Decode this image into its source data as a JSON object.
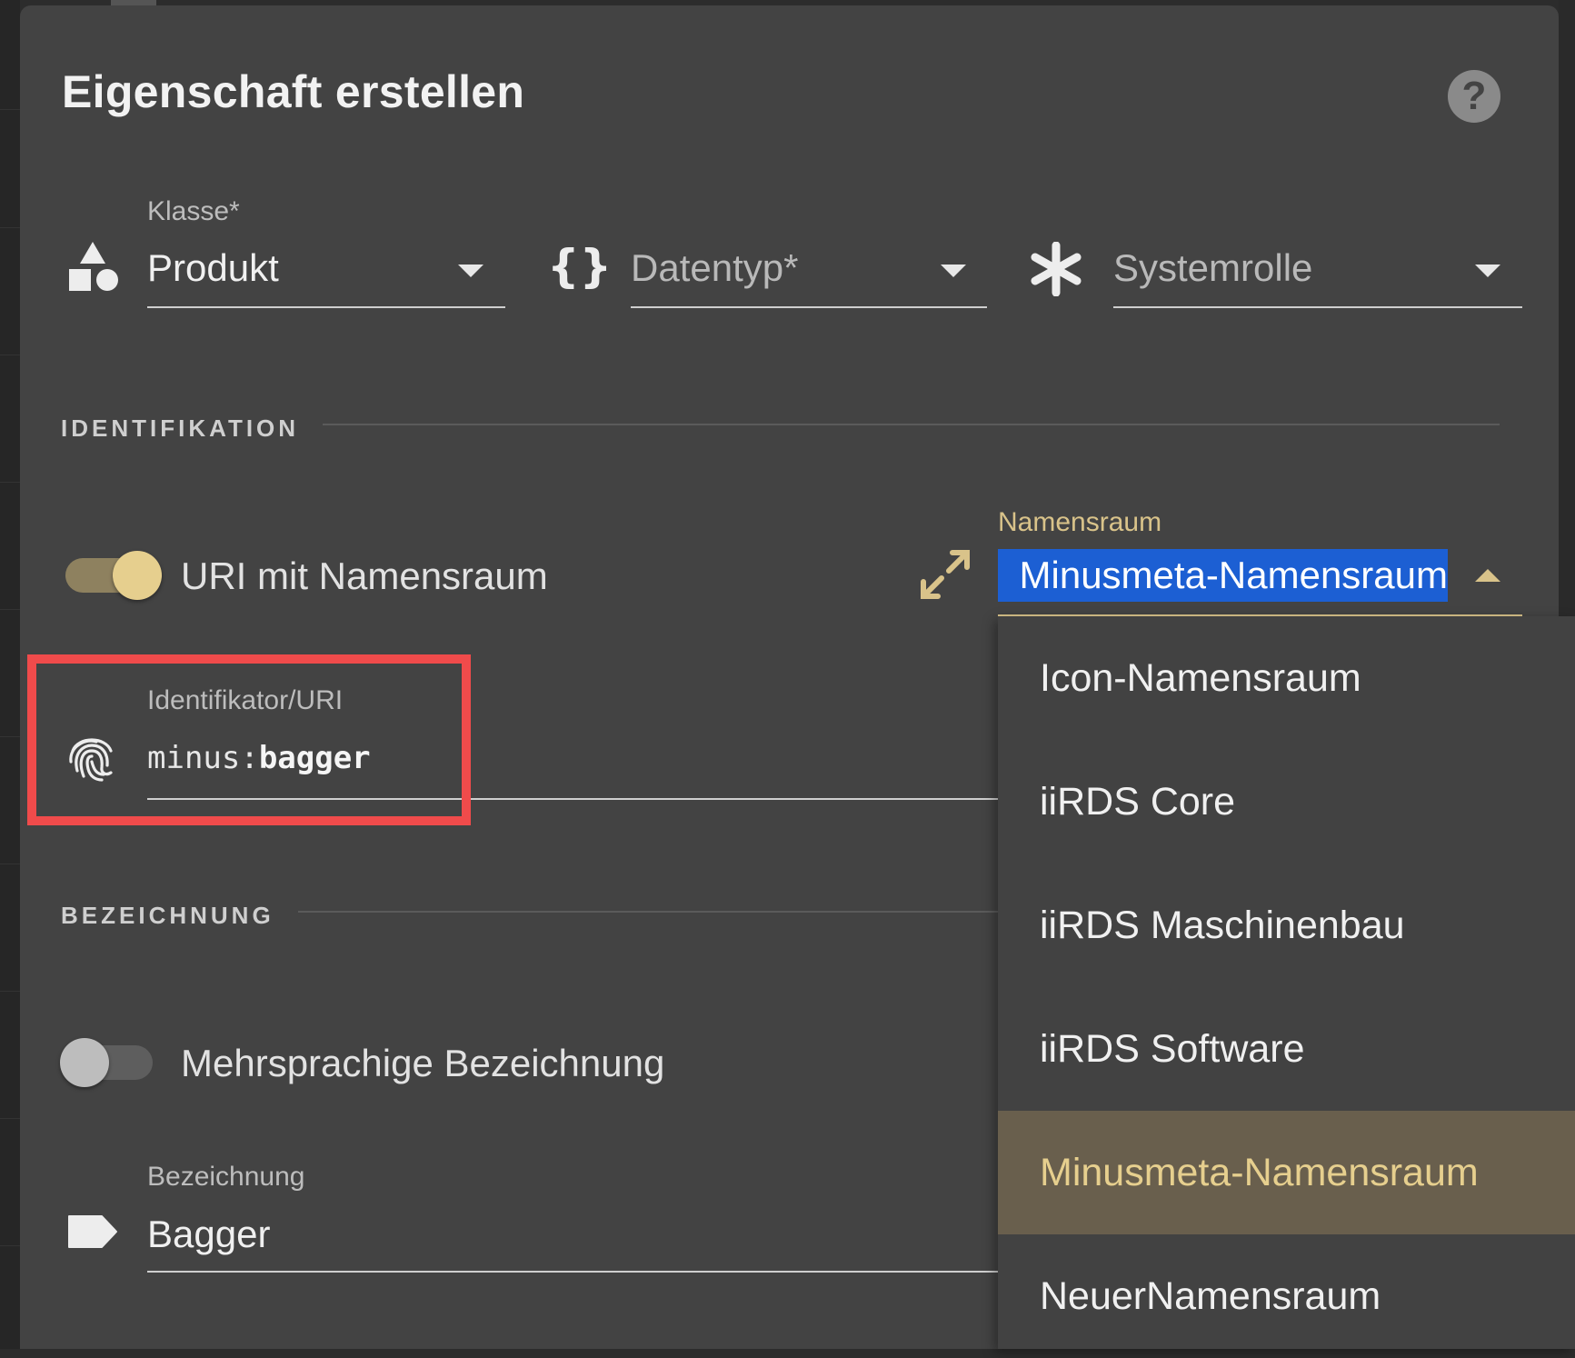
{
  "dialog": {
    "title": "Eigenschaft erstellen"
  },
  "fields": {
    "klasse": {
      "label": "Klasse*",
      "value": "Produkt"
    },
    "datentyp": {
      "placeholder": "Datentyp*"
    },
    "systemrolle": {
      "placeholder": "Systemrolle"
    }
  },
  "sections": {
    "identifikation": "IDENTIFIKATION",
    "bezeichnung": "BEZEICHNUNG"
  },
  "uri_toggle": {
    "label": "URI mit Namensraum",
    "on": true
  },
  "namespace": {
    "label": "Namensraum",
    "value": "Minusmeta-Namensraum"
  },
  "identifier": {
    "label": "Identifikator/URI",
    "prefix": "minus:",
    "local": "bagger"
  },
  "multilang_toggle": {
    "label": "Mehrsprachige Bezeichnung",
    "on": false
  },
  "bezeichnung": {
    "label": "Bezeichnung",
    "value": "Bagger"
  },
  "dropdown": {
    "options": [
      "Icon-Namensraum",
      "iiRDS Core",
      "iiRDS Maschinenbau",
      "iiRDS Software",
      "Minusmeta-Namensraum",
      "NeuerNamensraum"
    ],
    "selected": "Minusmeta-Namensraum"
  },
  "colors": {
    "accent": "#d9c38a",
    "selection": "#1c5fd3",
    "highlight": "#f04b4b",
    "dialog_bg": "#434343",
    "selected_item_bg": "#695f4d"
  }
}
